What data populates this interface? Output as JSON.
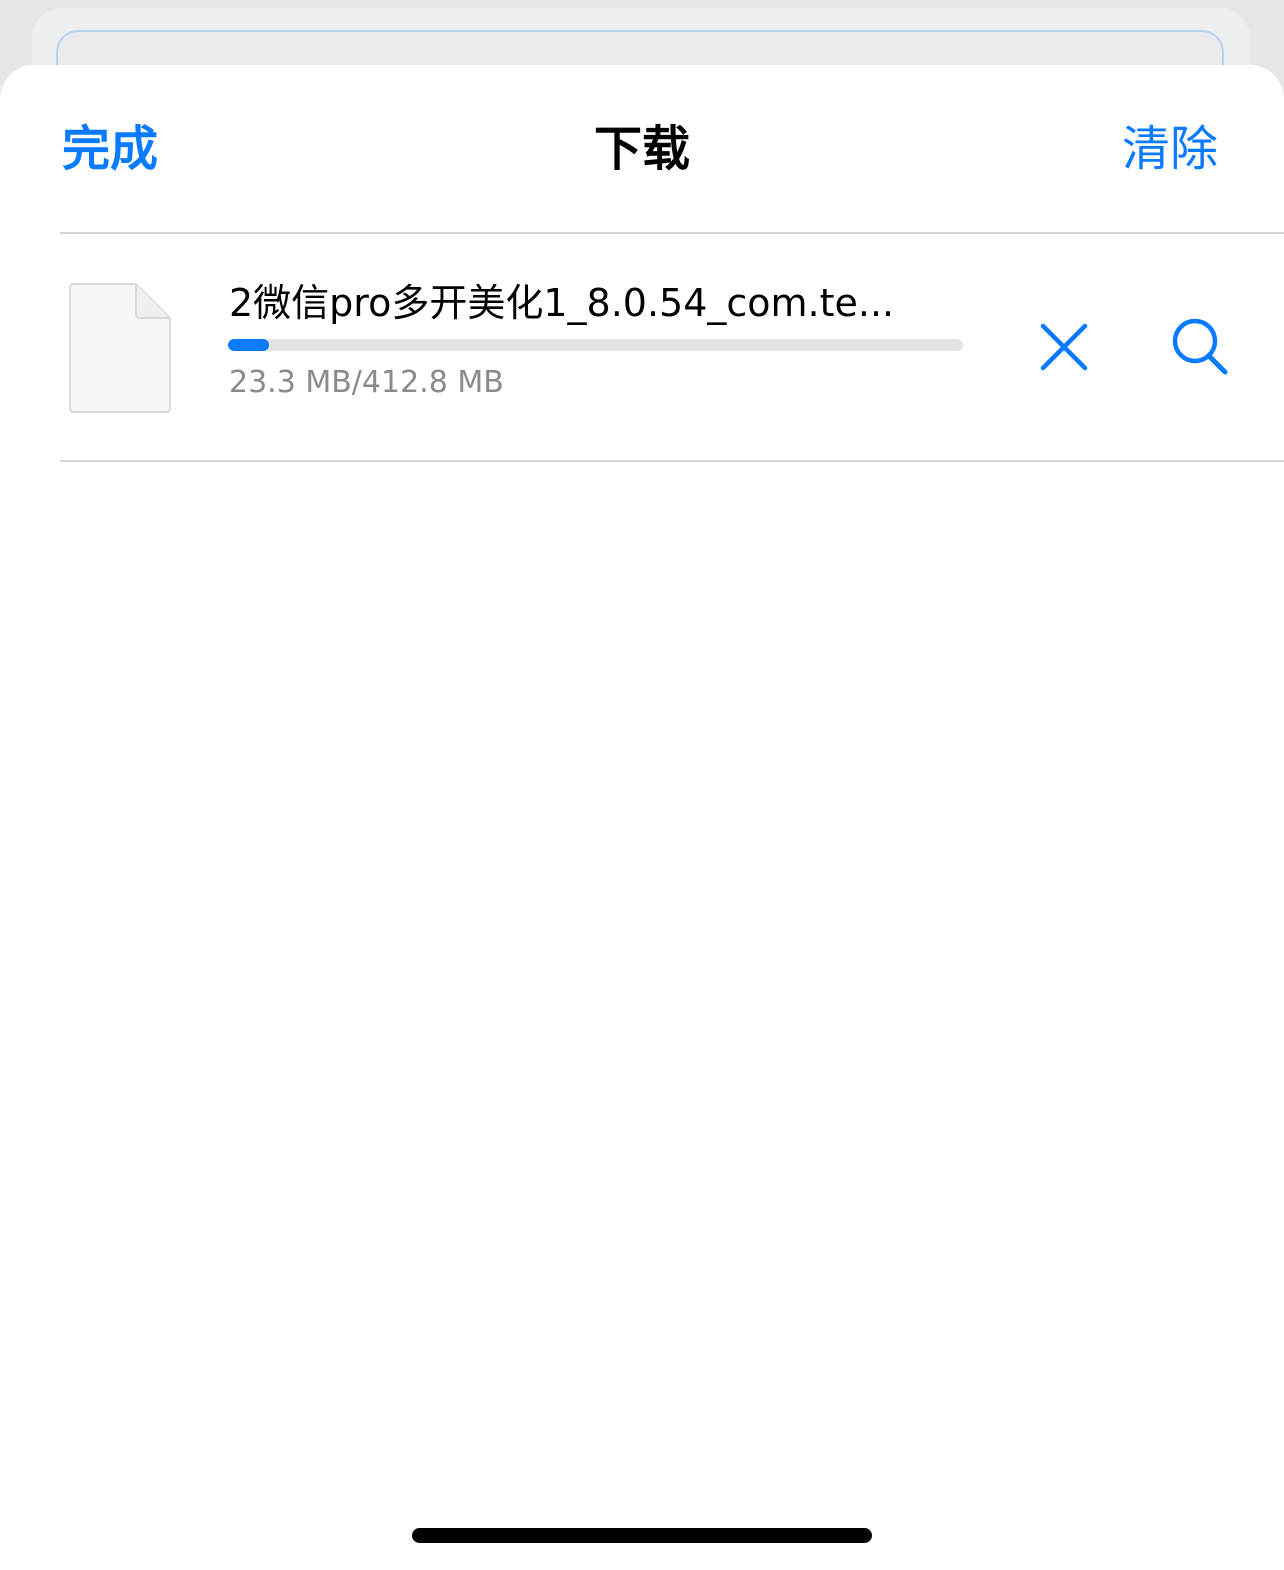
{
  "nav": {
    "done_label": "完成",
    "title": "下载",
    "clear_label": "清除"
  },
  "downloads": [
    {
      "file_name": "2微信pro多开美化1_8.0.54_com.te...",
      "size_text": "23.3 MB/412.8 MB",
      "progress": 0.0564,
      "icon": "document-icon",
      "actions": [
        "close-icon",
        "search-icon"
      ]
    }
  ],
  "colors": {
    "accent": "#0a7aff",
    "secondary_text": "#8a8a8e",
    "separator": "#d6d6da"
  }
}
